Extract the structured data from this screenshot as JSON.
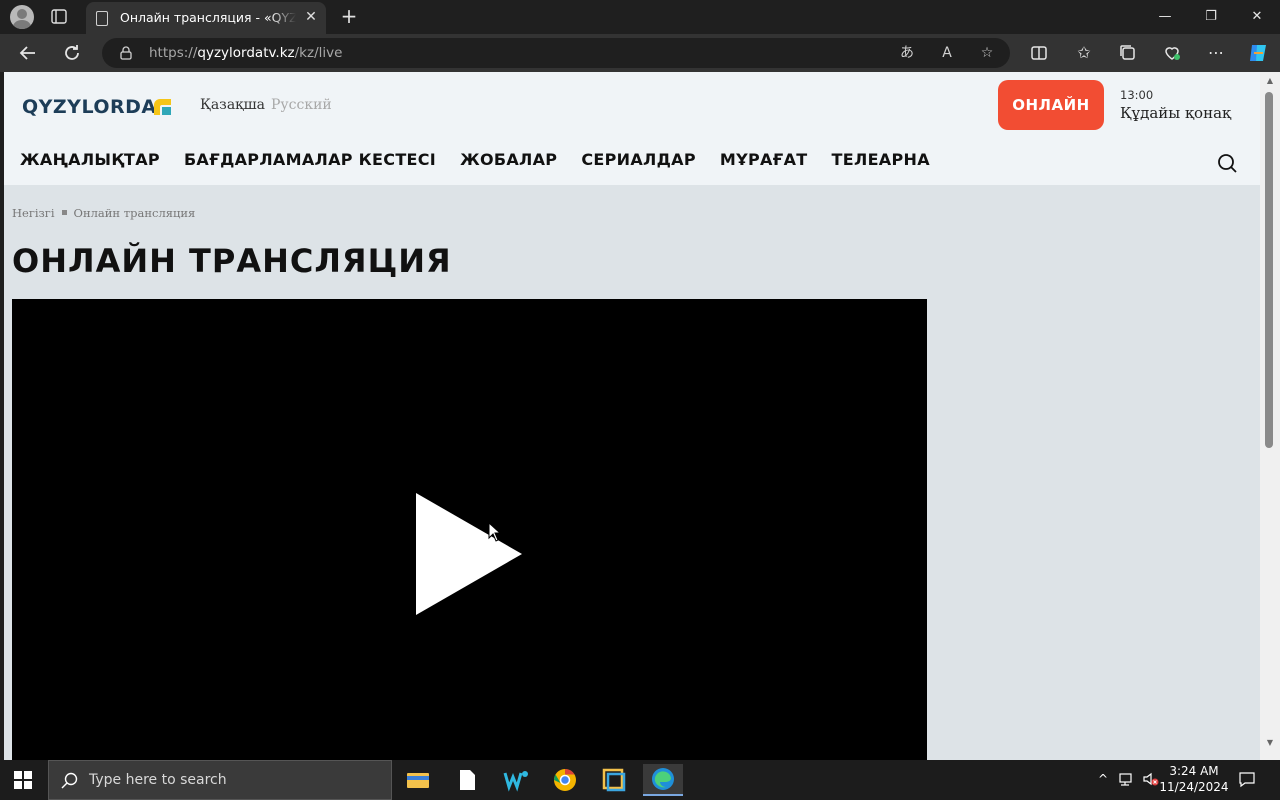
{
  "browser": {
    "tab_title": "Онлайн трансляция - «QYZYLORDA",
    "tab_close": "✕",
    "new_tab": "+",
    "url_scheme": "https://",
    "url_host": "qyzylordatv.kz",
    "url_path": "/kz/live",
    "window_controls": {
      "minimize": "—",
      "restore": "❐",
      "close": "✕"
    }
  },
  "site": {
    "logo_text": "QYZYLORDA",
    "languages": {
      "kazakh": "Қазақша",
      "russian": "Русский"
    },
    "online_button": "ОНЛАЙН",
    "now_playing": {
      "time": "13:00",
      "title": "Құдайы қонақ"
    },
    "nav": [
      "ЖАҢАЛЫҚТАР",
      "БАҒДАРЛАМАЛАР КЕСТЕСІ",
      "ЖОБАЛАР",
      "СЕРИАЛДАР",
      "МҰРАҒАТ",
      "ТЕЛЕАРНА"
    ],
    "breadcrumb": {
      "home": "Негізгі",
      "current": "Онлайн трансляция"
    },
    "page_title": "ОНЛАЙН ТРАНСЛЯЦИЯ"
  },
  "colors": {
    "accent": "#f24d33",
    "logo_blue": "#1d3d58",
    "logo_mark": "#f5c518"
  },
  "taskbar": {
    "search_placeholder": "Type here to search",
    "time": "3:24 AM",
    "date": "11/24/2024",
    "apps": [
      "file-explorer",
      "notepad",
      "wps",
      "chrome",
      "sandbox",
      "edge"
    ]
  }
}
